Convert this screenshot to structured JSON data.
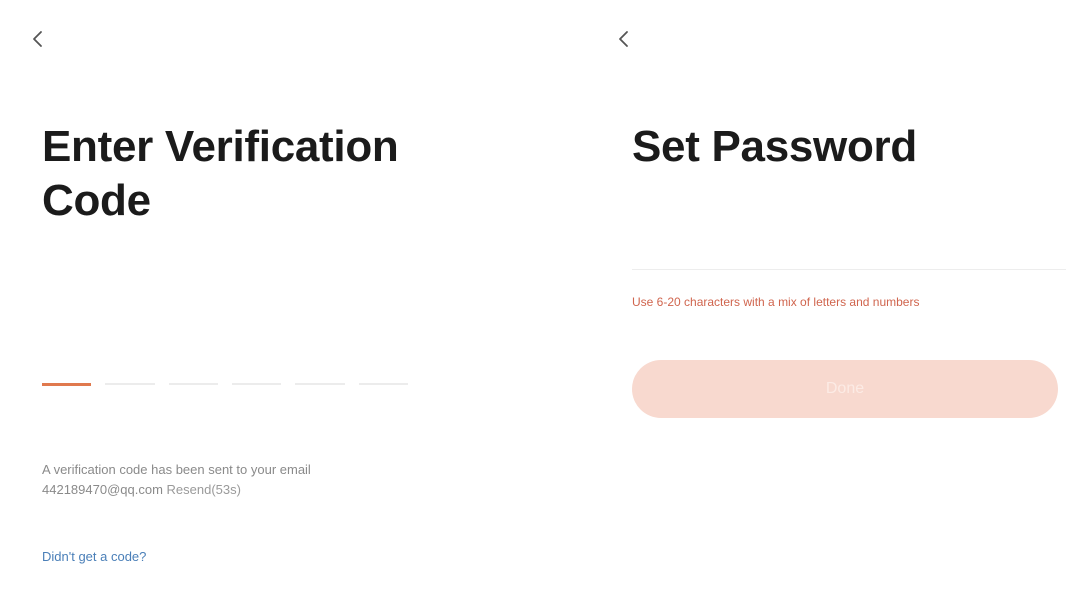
{
  "verification_screen": {
    "title_line1": "Enter Verification",
    "title_line2": "Code",
    "hint_line1": "A verification code has been sent to your email",
    "hint_line2_email": "442189470@qq.com",
    "resend_label": "Resend(53s)",
    "no_code_link": "Didn't get a code?",
    "code_slots": 6,
    "active_slot": 1
  },
  "password_screen": {
    "title": "Set Password",
    "password_value": "",
    "hint": "Use 6-20 characters with a mix of letters and numbers",
    "done_label": "Done"
  },
  "colors": {
    "accent": "#e0794e",
    "link": "#4a7fb8",
    "button_disabled": "#f8d9cf",
    "hint_error": "#d0654e"
  },
  "icons": {
    "back": "chevron-left-icon"
  }
}
